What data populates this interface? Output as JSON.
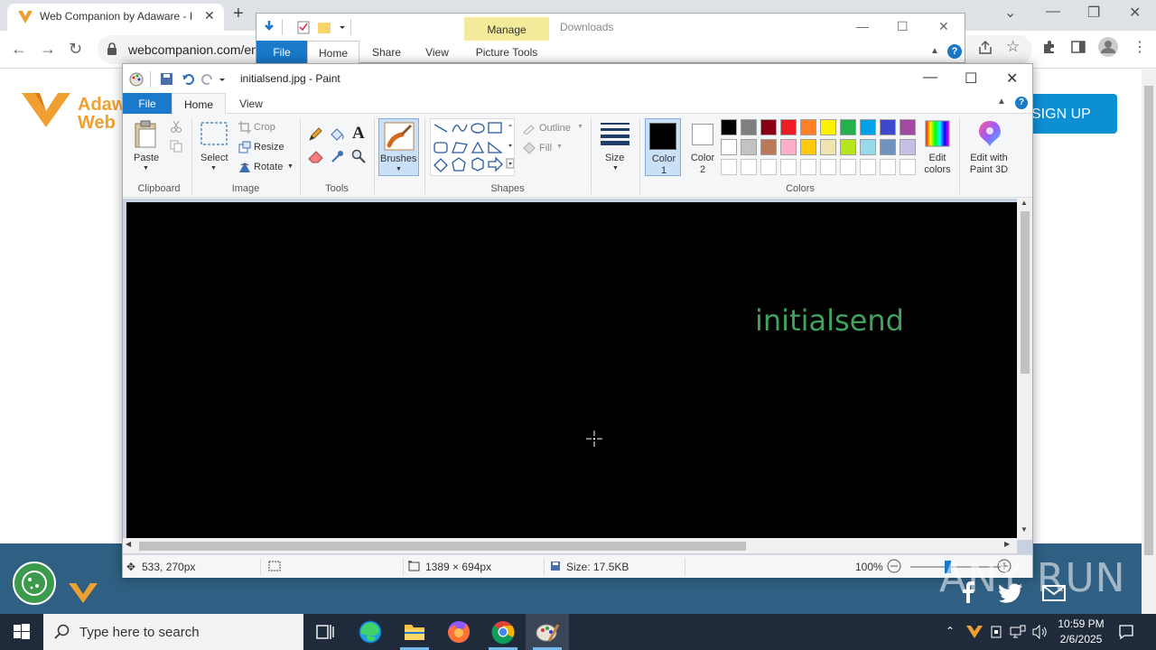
{
  "browser": {
    "tab_title": "Web Companion by Adaware - I",
    "url": "webcompanion.com/en",
    "brand_colors": {
      "accent": "#f0a030",
      "signup": "#0d8fd4",
      "footer": "#2f5f82"
    }
  },
  "webpage": {
    "logo_line1": "Adaw",
    "logo_line2": "Web",
    "signup_label": "SIGN UP"
  },
  "explorer": {
    "manage_label": "Manage",
    "window_title": "Downloads",
    "tabs": [
      "File",
      "Home",
      "Share",
      "View",
      "Picture Tools"
    ]
  },
  "paint": {
    "title": "initialsend.jpg - Paint",
    "tabs": {
      "file": "File",
      "home": "Home",
      "view": "View"
    },
    "clipboard": {
      "paste": "Paste",
      "group": "Clipboard"
    },
    "image": {
      "select": "Select",
      "crop": "Crop",
      "resize": "Resize",
      "rotate": "Rotate",
      "group": "Image"
    },
    "tools": {
      "group": "Tools"
    },
    "brushes": {
      "label": "Brushes"
    },
    "shapes": {
      "outline": "Outline",
      "fill": "Fill",
      "group": "Shapes"
    },
    "size": {
      "label": "Size"
    },
    "colors": {
      "color1": "Color 1",
      "color2": "Color 2",
      "edit_colors": "Edit colors",
      "edit_3d": "Edit with Paint 3D",
      "group": "Colors",
      "palette_row1": [
        "#000000",
        "#7f7f7f",
        "#880015",
        "#ed1c24",
        "#ff7f27",
        "#fff200",
        "#22b14c",
        "#00a2e8",
        "#3f48cc",
        "#a349a4"
      ],
      "palette_row2": [
        "#ffffff",
        "#c3c3c3",
        "#b97a57",
        "#ffaec9",
        "#ffc90e",
        "#efe4b0",
        "#b5e61d",
        "#99d9ea",
        "#7092be",
        "#c8bfe7"
      ],
      "palette_row3": [
        "#ffffff",
        "#ffffff",
        "#ffffff",
        "#ffffff",
        "#ffffff",
        "#ffffff",
        "#ffffff",
        "#ffffff",
        "#ffffff",
        "#ffffff"
      ]
    },
    "canvas_text": "initialsend",
    "canvas_text_color": "#3da35d",
    "status": {
      "cursor_pos": "533, 270px",
      "dimensions": "1389 × 694px",
      "size": "Size: 17.5KB",
      "zoom": "100%"
    }
  },
  "watermark": "ANY RUN",
  "taskbar": {
    "search_placeholder": "Type here to search",
    "time": "10:59 PM",
    "date": "2/6/2025"
  }
}
